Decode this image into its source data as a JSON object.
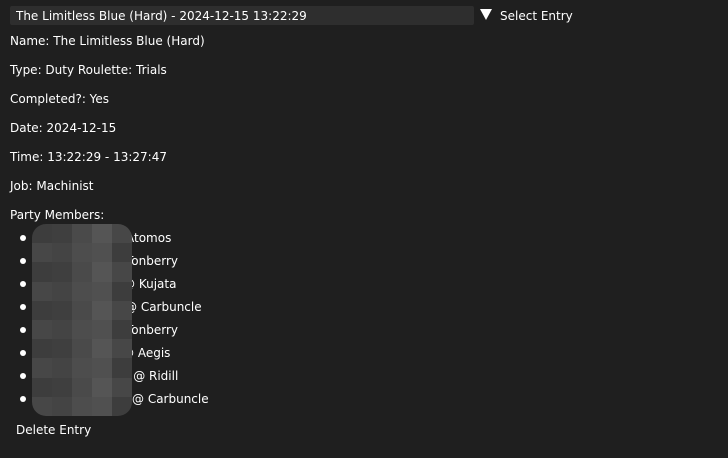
{
  "selector": {
    "selected": "The Limitless Blue (Hard) - 2024-12-15 13:22:29",
    "label": "Select Entry"
  },
  "details": {
    "name": "Name: The Limitless Blue (Hard)",
    "type": "Type: Duty Roulette: Trials",
    "completed": "Completed?: Yes",
    "date": "Date: 2024-12-15",
    "time": "Time: 13:22:29 - 13:27:47",
    "job": "Job: Machinist",
    "party_heading": "Party Members:"
  },
  "party_members": [
    "Atomos",
    "Tonberry",
    "@ Kujata",
    "@ Carbuncle",
    "Tonberry",
    "@ Aegis",
    "e @ Ridill",
    "@ Carbuncle"
  ],
  "actions": {
    "delete_label": "Delete Entry"
  }
}
